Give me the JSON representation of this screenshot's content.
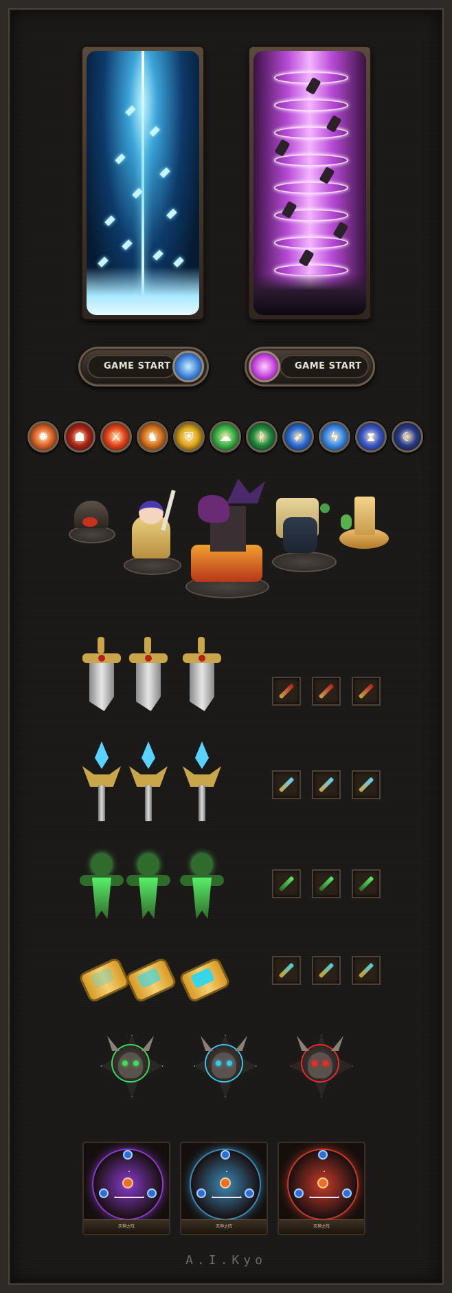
{
  "portals": [
    {
      "name": "ice-portal",
      "color": "#3aa3d8"
    },
    {
      "name": "void-portal",
      "color": "#b64ad6"
    }
  ],
  "buttons": {
    "left": {
      "label": "GAME START",
      "orb_color": "#3a7bd6"
    },
    "right": {
      "label": "GAME START",
      "orb_color": "#c040d8"
    }
  },
  "skills": [
    {
      "icon": "fire-burst-icon",
      "color": "#e0662a"
    },
    {
      "icon": "demon-mask-icon",
      "color": "#b02418"
    },
    {
      "icon": "flame-slash-icon",
      "color": "#e8461c"
    },
    {
      "icon": "warrior-aura-icon",
      "color": "#d8741e"
    },
    {
      "icon": "golden-shield-icon",
      "color": "#e0a81c"
    },
    {
      "icon": "poison-cloud-icon",
      "color": "#3ab84a"
    },
    {
      "icon": "green-rune-icon",
      "color": "#1e8a3e"
    },
    {
      "icon": "ice-arrow-icon",
      "color": "#2a6ed8"
    },
    {
      "icon": "lightning-icon",
      "color": "#3a8cf0"
    },
    {
      "icon": "hourglass-icon",
      "color": "#3a5ad0"
    },
    {
      "icon": "shadow-wolf-icon",
      "color": "#283c8a"
    }
  ],
  "weapon_rows": [
    {
      "name": "sword",
      "color": "#c9a64a",
      "accent": "#b8201c"
    },
    {
      "name": "ice-staff",
      "color": "#c9a64a",
      "accent": "#5ad2ff"
    },
    {
      "name": "totem",
      "color": "#2f6b2a",
      "accent": "#5af06a"
    },
    {
      "name": "bracer",
      "color": "#d89a24",
      "accent": "#38d4e8"
    }
  ],
  "badges": [
    {
      "name": "green-skull-badge",
      "color": "#3ae05a"
    },
    {
      "name": "blue-skull-badge",
      "color": "#3ac8f0"
    },
    {
      "name": "red-skull-badge",
      "color": "#f02a2a"
    }
  ],
  "cards": [
    {
      "name": "purple-magic-circle",
      "color": "#8a3ad0",
      "caption": "天神之阵"
    },
    {
      "name": "blue-magic-circle",
      "color": "#3a8ab8",
      "caption": "天神之阵"
    },
    {
      "name": "red-magic-circle",
      "color": "#c83a2a",
      "caption": "天神之阵"
    }
  ],
  "signature": "A.I.Kyo"
}
